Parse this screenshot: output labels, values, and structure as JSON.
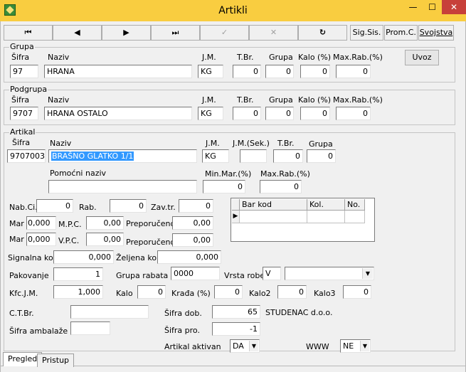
{
  "window": {
    "title": "Artikli",
    "minimize_glyph": "—",
    "maximize_glyph": "☐",
    "close_glyph": "✕"
  },
  "toolbar": {
    "first_glyph": "⏮",
    "prev_glyph": "◀",
    "next_glyph": "▶",
    "last_glyph": "⏭",
    "confirm_glyph": "✓",
    "cancel_glyph": "✕",
    "refresh_glyph": "↻",
    "sig_sis": "Sig.Sis.",
    "prom_c": "Prom.C.",
    "svojstva": "Svojstva"
  },
  "grupa": {
    "title": "Grupa",
    "labels": {
      "sifra": "Šifra",
      "naziv": "Naziv",
      "jm": "J.M.",
      "tbr": "T.Br.",
      "grupa": "Grupa",
      "kalo": "Kalo (%)",
      "maxrab": "Max.Rab.(%)"
    },
    "values": {
      "sifra": "97",
      "naziv": "HRANA",
      "jm": "KG",
      "tbr": "0",
      "grupa": "0",
      "kalo": "0",
      "maxrab": "0"
    },
    "uvoz_button": "Uvoz"
  },
  "podgrupa": {
    "title": "Podgrupa",
    "labels": {
      "sifra": "Šifra",
      "naziv": "Naziv",
      "jm": "J.M.",
      "tbr": "T.Br.",
      "grupa": "Grupa",
      "kalo": "Kalo (%)",
      "maxrab": "Max.Rab.(%)"
    },
    "values": {
      "sifra": "9707",
      "naziv": "HRANA OSTALO",
      "jm": "KG",
      "tbr": "0",
      "grupa": "0",
      "kalo": "0",
      "maxrab": "0"
    }
  },
  "artikal": {
    "title": "Artikal",
    "labels": {
      "sifra": "Šifra",
      "naziv": "Naziv",
      "jm": "J.M.",
      "jm_sek": "J.M.(Sek.)",
      "tbr": "T.Br.",
      "grupa": "Grupa",
      "pomocni_naziv": "Pomoćni naziv",
      "min_mar": "Min.Mar.(%)",
      "max_rab": "Max.Rab.(%)",
      "nab_ci": "Nab.Ci.",
      "rab": "Rab.",
      "zav_tr": "Zav.tr.",
      "mar1": "Mar",
      "mpc": "M.P.C.",
      "preporuceno1": "Preporučeno",
      "mar2": "Mar",
      "vpc": "V.P.C.",
      "preporuceno2": "Preporučeno",
      "signalna_kol": "Signalna kol.",
      "zeljena_kol": "Željena kol.",
      "pakovanje": "Pakovanje",
      "grupa_rabata": "Grupa rabata",
      "vrsta_robe": "Vrsta robe",
      "kfc_jm": "Kfc.J.M.",
      "kalo": "Kalo",
      "krada": "Krađa (%)",
      "kalo2": "Kalo2",
      "kalo3": "Kalo3",
      "ctbr": "C.T.Br.",
      "sifra_dob": "Šifra dob.",
      "sifra_ambalaze": "Šifra ambalaže",
      "sifra_pro": "Šifra pro.",
      "artikal_aktivan": "Artikal aktivan",
      "www": "WWW"
    },
    "values": {
      "sifra": "9707003",
      "naziv": "BRAŠNO GLATKO 1/1",
      "jm": "KG",
      "jm_sek": "",
      "tbr": "0",
      "grupa": "0",
      "pomocni_naziv": "",
      "min_mar": "0",
      "max_rab": "0",
      "nab_ci": "0",
      "rab": "0",
      "zav_tr": "0",
      "mar1": "0,000",
      "mpc": "0,00",
      "preporuceno1": "0,00",
      "mar2": "0,000",
      "vpc": "0,00",
      "preporuceno2": "0,00",
      "signalna_kol": "0,000",
      "zeljena_kol": "0,000",
      "pakovanje": "1",
      "grupa_rabata": "0000",
      "vrsta_robe": "V",
      "vrsta_robe_opis": "",
      "kfc_jm": "1,000",
      "kalo": "0",
      "krada": "0",
      "kalo2": "0",
      "kalo3": "0",
      "ctbr": "",
      "sifra_dob": "65",
      "dobavljac": "STUDENAC d.o.o.",
      "sifra_ambalaze": "",
      "sifra_pro": "-1",
      "artikal_aktivan": "DA",
      "www": "NE"
    },
    "barcode_grid": {
      "columns": [
        "Bar kod",
        "Kol.",
        "No."
      ],
      "row_marker": "▶"
    }
  },
  "tabs": [
    {
      "label": "Pregled"
    },
    {
      "label": "Pristup"
    }
  ],
  "colors": {
    "titlebar": "#f9cd40",
    "close": "#c7403a",
    "selection": "#3399ff"
  }
}
